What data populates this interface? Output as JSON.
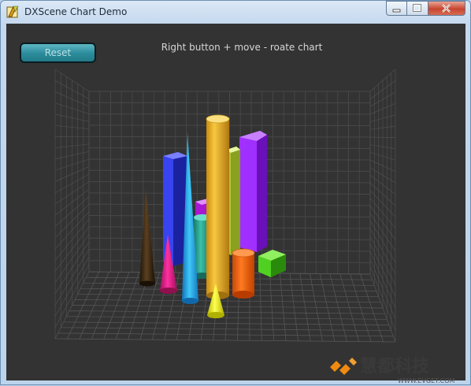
{
  "window": {
    "title": "DXScene Chart Demo",
    "accent": "#6d8fb3",
    "controls": {
      "minimize": "minimize-icon",
      "maximize": "maximize-icon",
      "close": "close-icon"
    }
  },
  "toolbar": {
    "reset_label": "Reset"
  },
  "hint": "Right button + move - roate chart",
  "scene": {
    "background": "#333333",
    "grid": true,
    "objects": [
      {
        "shape": "cone",
        "color": "#3a2a14"
      },
      {
        "shape": "cone",
        "color": "#e0178a"
      },
      {
        "shape": "box",
        "color": "#2c34d6"
      },
      {
        "shape": "cone",
        "color": "#22a8e6"
      },
      {
        "shape": "box",
        "color": "#b020d8"
      },
      {
        "shape": "cylinder",
        "color": "#2aaa9a"
      },
      {
        "shape": "cylinder",
        "color": "#e8b020"
      },
      {
        "shape": "box",
        "color": "#c8e040"
      },
      {
        "shape": "box",
        "color": "#9a22f4"
      },
      {
        "shape": "cylinder",
        "color": "#f06010"
      },
      {
        "shape": "box",
        "color": "#48d020"
      },
      {
        "shape": "cone",
        "color": "#f0f020"
      }
    ]
  },
  "watermark": {
    "text": "慧都科技",
    "url": "WWW.EVGET.COM"
  }
}
